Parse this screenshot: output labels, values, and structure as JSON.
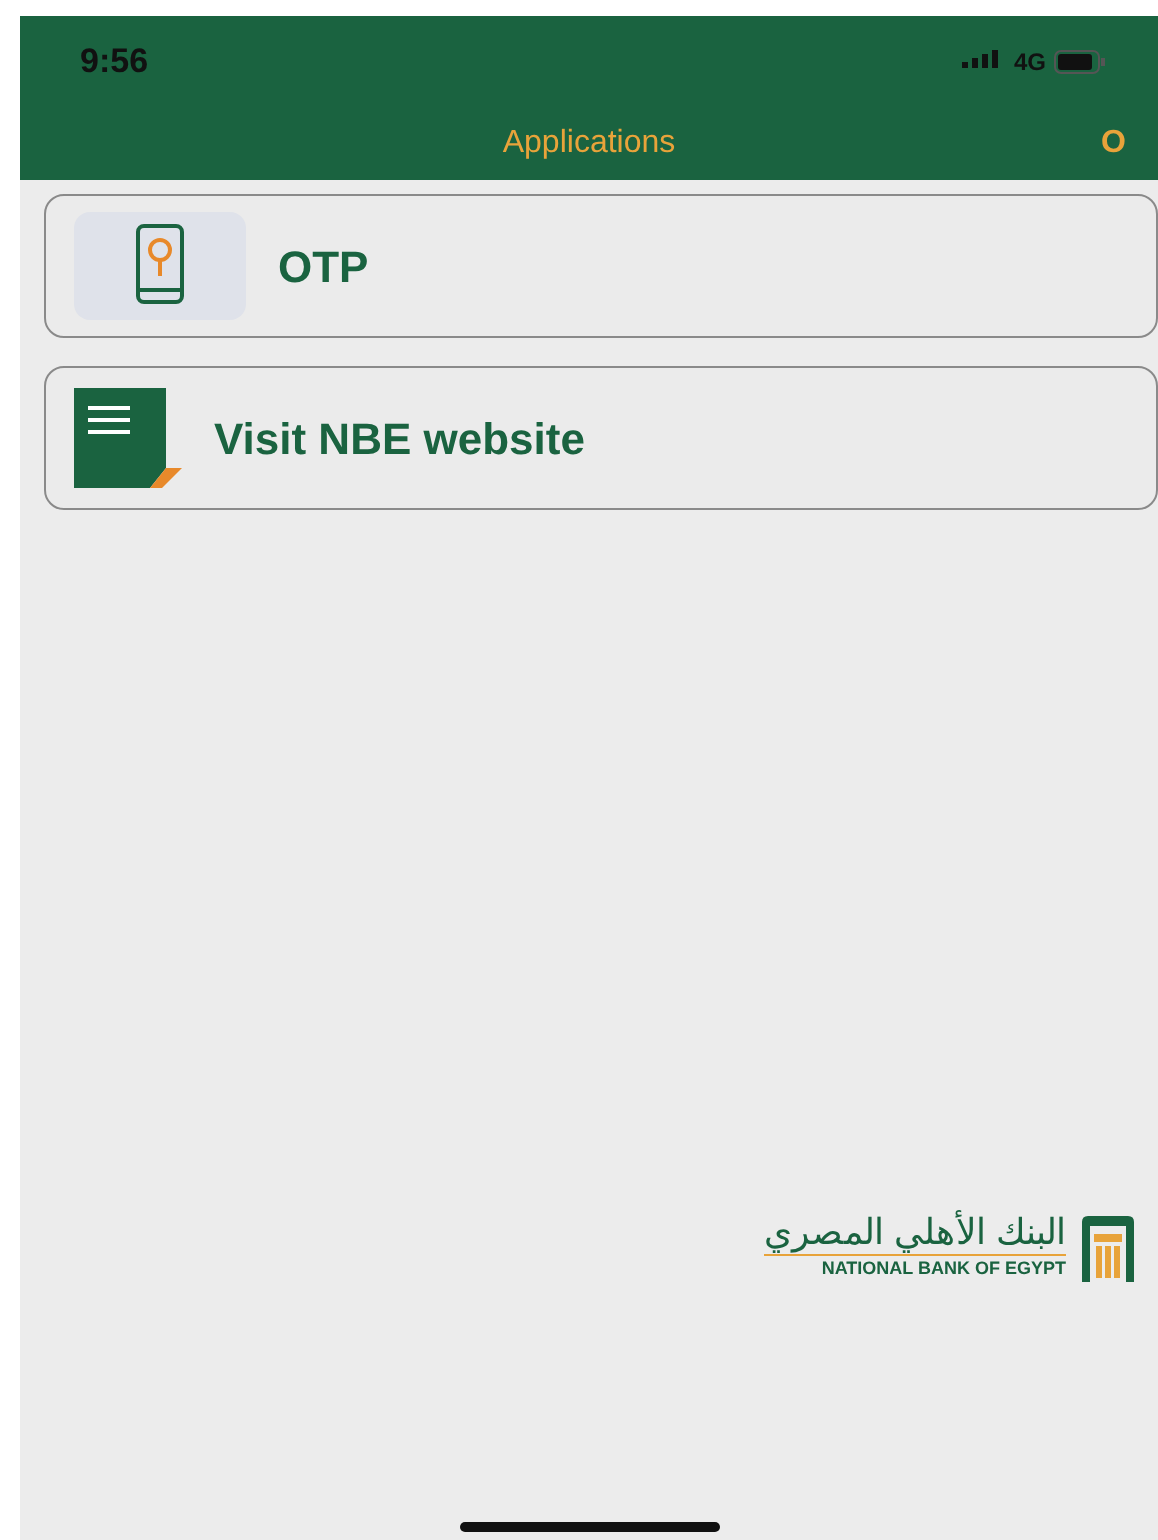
{
  "status_bar": {
    "time": "9:56",
    "network": "4G"
  },
  "header": {
    "title": "Applications",
    "action": "O"
  },
  "items": [
    {
      "kind": "otp",
      "label": "OTP"
    },
    {
      "kind": "web",
      "label": "Visit NBE website"
    }
  ],
  "logo": {
    "arabic": "البنك الأهلي المصري",
    "english": "NATIONAL BANK OF EGYPT"
  }
}
